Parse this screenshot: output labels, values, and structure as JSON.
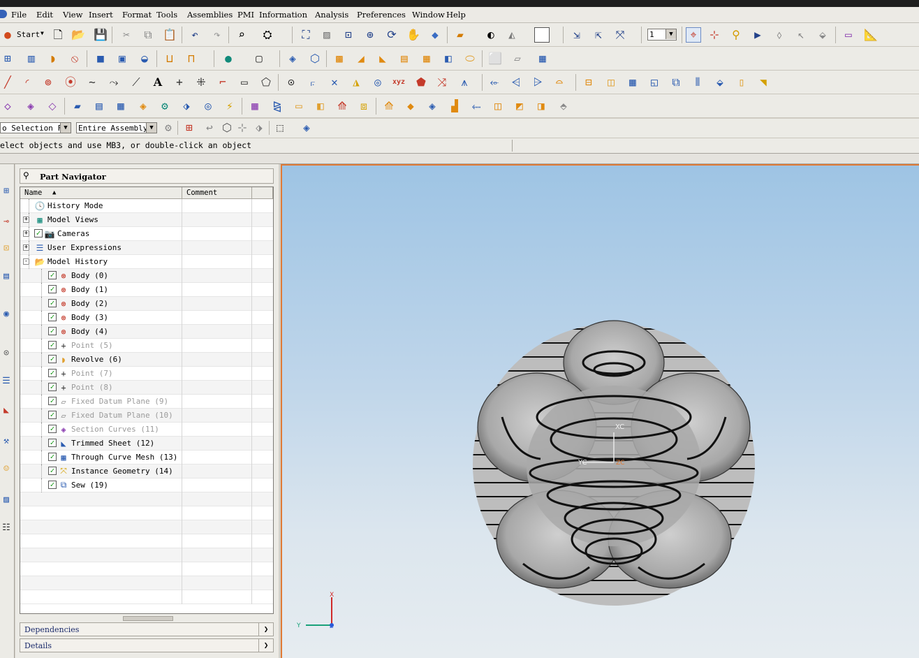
{
  "menu": [
    "File",
    "Edit",
    "View",
    "Insert",
    "Format",
    "Tools",
    "Assemblies",
    "PMI",
    "Information",
    "Analysis",
    "Preferences",
    "Window",
    "Help"
  ],
  "toolbar": {
    "start_label": "Start",
    "layer_value": "1"
  },
  "selection": {
    "filter_value": "o Selection Fi",
    "scope_value": "Entire Assembly"
  },
  "status": {
    "message": "elect objects and use MB3, or double-click an object"
  },
  "navigator": {
    "title": "Part Navigator",
    "columns": {
      "name": "Name",
      "comment": "Comment"
    },
    "items": [
      {
        "label": "History Mode",
        "icon": "clock-icon",
        "level": 0,
        "check": false,
        "expander": "",
        "grey": false
      },
      {
        "label": "Model Views",
        "icon": "views-icon",
        "level": 0,
        "check": false,
        "expander": "+",
        "grey": false
      },
      {
        "label": "Cameras",
        "icon": "camera-icon",
        "level": 0,
        "check": true,
        "expander": "+",
        "grey": false
      },
      {
        "label": "User Expressions",
        "icon": "expressions-icon",
        "level": 0,
        "check": false,
        "expander": "+",
        "grey": false
      },
      {
        "label": "Model History",
        "icon": "folder-icon",
        "level": 0,
        "check": false,
        "expander": "-",
        "grey": false
      },
      {
        "label": "Body (0)",
        "icon": "body-icon",
        "level": 1,
        "check": true,
        "expander": "",
        "grey": false
      },
      {
        "label": "Body (1)",
        "icon": "body-icon",
        "level": 1,
        "check": true,
        "expander": "",
        "grey": false
      },
      {
        "label": "Body (2)",
        "icon": "body-icon",
        "level": 1,
        "check": true,
        "expander": "",
        "grey": false
      },
      {
        "label": "Body (3)",
        "icon": "body-icon",
        "level": 1,
        "check": true,
        "expander": "",
        "grey": false
      },
      {
        "label": "Body (4)",
        "icon": "body-icon",
        "level": 1,
        "check": true,
        "expander": "",
        "grey": false
      },
      {
        "label": "Point (5)",
        "icon": "point-icon",
        "level": 1,
        "check": true,
        "expander": "",
        "grey": true
      },
      {
        "label": "Revolve (6)",
        "icon": "revolve-icon",
        "level": 1,
        "check": true,
        "expander": "",
        "grey": false
      },
      {
        "label": "Point (7)",
        "icon": "point-icon",
        "level": 1,
        "check": true,
        "expander": "",
        "grey": true
      },
      {
        "label": "Point (8)",
        "icon": "point-icon",
        "level": 1,
        "check": true,
        "expander": "",
        "grey": true
      },
      {
        "label": "Fixed Datum Plane (9)",
        "icon": "datum-plane-icon",
        "level": 1,
        "check": true,
        "expander": "",
        "grey": true
      },
      {
        "label": "Fixed Datum Plane (10)",
        "icon": "datum-plane-icon",
        "level": 1,
        "check": true,
        "expander": "",
        "grey": true
      },
      {
        "label": "Section Curves (11)",
        "icon": "section-curves-icon",
        "level": 1,
        "check": true,
        "expander": "",
        "grey": true
      },
      {
        "label": "Trimmed Sheet (12)",
        "icon": "trimmed-sheet-icon",
        "level": 1,
        "check": true,
        "expander": "",
        "grey": false
      },
      {
        "label": "Through Curve Mesh (13)",
        "icon": "curve-mesh-icon",
        "level": 1,
        "check": true,
        "expander": "",
        "grey": false
      },
      {
        "label": "Instance Geometry (14)",
        "icon": "instance-geometry-icon",
        "level": 1,
        "check": true,
        "expander": "",
        "grey": false
      },
      {
        "label": "Sew (19)",
        "icon": "sew-icon",
        "level": 1,
        "check": true,
        "expander": "",
        "grey": false
      }
    ],
    "panels": [
      "Dependencies",
      "Details"
    ]
  },
  "graphics": {
    "wcs_labels": {
      "x": "XC",
      "y": "YC",
      "z": "ZC"
    },
    "triad_labels": {
      "x": "X",
      "y": "Y",
      "z": "Z"
    }
  },
  "colors": {
    "viewport_top": "#9ec4e4",
    "viewport_bottom": "#e6ecf0",
    "active_border": "#e07a35"
  }
}
